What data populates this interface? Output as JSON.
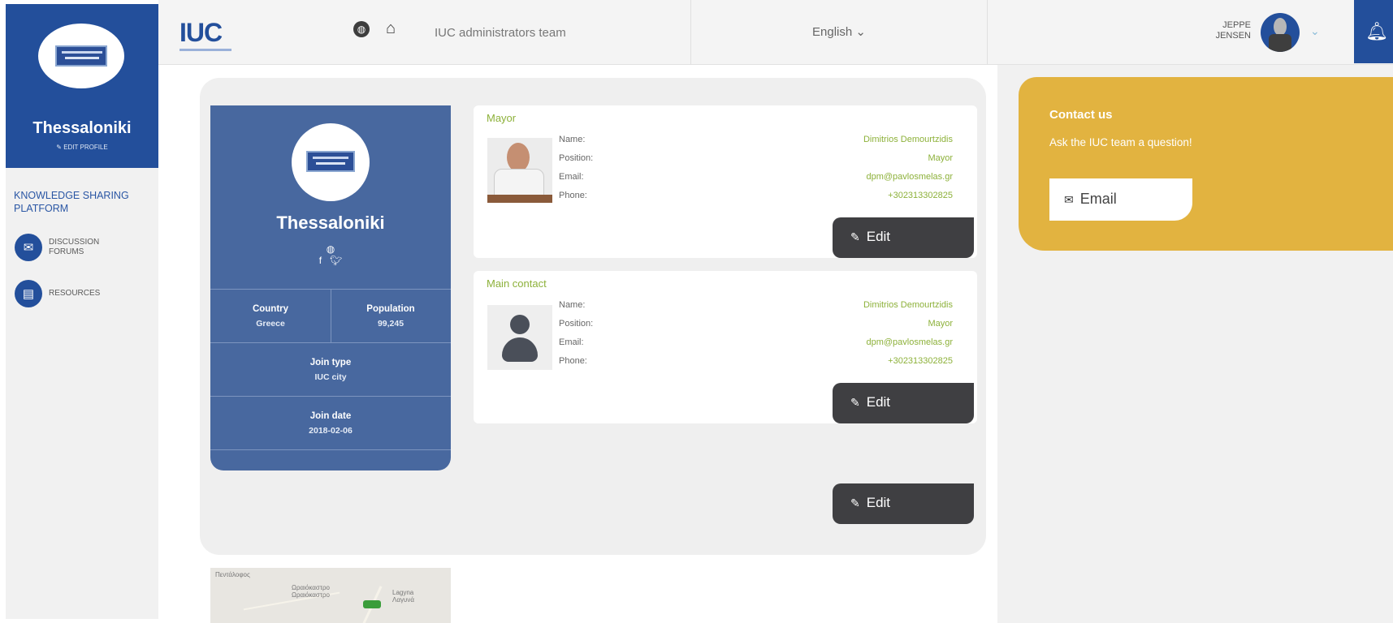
{
  "sidebar": {
    "city": "Thessaloniki",
    "edit_profile": "EDIT PROFILE",
    "section_title": "KNOWLEDGE SHARING PLATFORM",
    "items": [
      {
        "label": "DISCUSSION FORUMS",
        "icon": "chat-icon"
      },
      {
        "label": "RESOURCES",
        "icon": "document-icon"
      }
    ]
  },
  "topbar": {
    "brand": "IUC",
    "team": "IUC administrators team",
    "language": "English",
    "user_first": "JEPPE",
    "user_last": "JENSEN"
  },
  "city_card": {
    "name": "Thessaloniki",
    "country_label": "Country",
    "country": "Greece",
    "population_label": "Population",
    "population": "99,245",
    "join_type_label": "Join type",
    "join_type": "IUC city",
    "join_date_label": "Join date",
    "join_date": "2018-02-06"
  },
  "labels": {
    "name": "Name:",
    "position": "Position:",
    "email": "Email:",
    "phone": "Phone:",
    "edit": "Edit"
  },
  "mayor": {
    "title": "Mayor",
    "name": "Dimitrios Demourtzidis",
    "position": "Mayor",
    "email": "dpm@pavlosmelas.gr",
    "phone": "+302313302825"
  },
  "main_contact": {
    "title": "Main contact",
    "name": "Dimitrios Demourtzidis",
    "position": "Mayor",
    "email": "dpm@pavlosmelas.gr",
    "phone": "+302313302825"
  },
  "map": {
    "label1": "Πεντάλοφος",
    "label2": "Ωραιόκαστρο\nΩραιόκαστρο",
    "label3": "Lagyna\nΛαγυνά"
  },
  "contact_us": {
    "title": "Contact us",
    "subtitle": "Ask the IUC team a question!",
    "email_button": "Email"
  },
  "colors": {
    "brand_blue": "#234f9b",
    "card_blue": "#48689f",
    "accent_green": "#8db13a",
    "contact_yellow": "#e2b340",
    "dark_button": "#3f3f42"
  }
}
